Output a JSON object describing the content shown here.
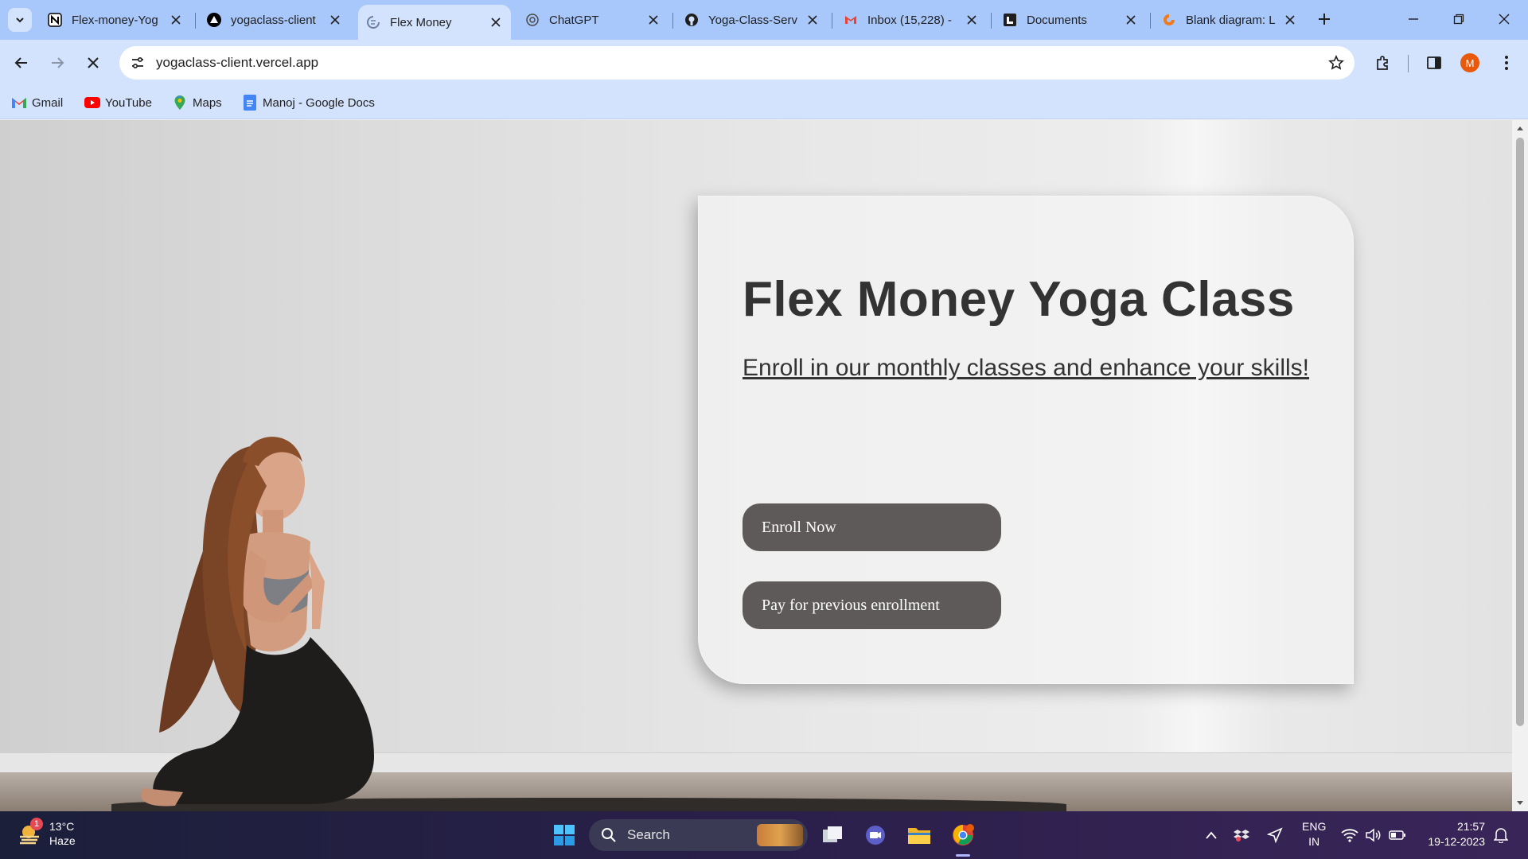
{
  "browser": {
    "tabs": [
      {
        "title": "Flex-money-Yog",
        "icon": "notion-icon",
        "active": false
      },
      {
        "title": "yogaclass-client",
        "icon": "vercel-icon",
        "active": false
      },
      {
        "title": "Flex Money",
        "icon": "loading-icon",
        "active": true
      },
      {
        "title": "ChatGPT",
        "icon": "chatgpt-icon",
        "active": false
      },
      {
        "title": "Yoga-Class-Serv",
        "icon": "github-icon",
        "active": false
      },
      {
        "title": "Inbox (15,228) -",
        "icon": "gmail-icon",
        "active": false
      },
      {
        "title": "Documents",
        "icon": "documents-icon",
        "active": false
      },
      {
        "title": "Blank diagram: L",
        "icon": "lucidchart-icon",
        "active": false
      }
    ],
    "url": "yogaclass-client.vercel.app",
    "profile_initial": "M",
    "bookmarks": [
      {
        "label": "Gmail",
        "icon": "gmail-icon"
      },
      {
        "label": "YouTube",
        "icon": "youtube-icon"
      },
      {
        "label": "Maps",
        "icon": "maps-icon"
      },
      {
        "label": "Manoj - Google Docs",
        "icon": "docs-icon"
      }
    ]
  },
  "page": {
    "title": "Flex Money Yoga Class",
    "subtitle": "Enroll in our monthly classes and enhance your skills!",
    "enroll_button": "Enroll Now",
    "pay_button": "Pay for previous enrollment"
  },
  "taskbar": {
    "weather_temp": "13°C",
    "weather_desc": "Haze",
    "weather_badge": "1",
    "search_label": "Search",
    "lang_line1": "ENG",
    "lang_line2": "IN",
    "time": "21:57",
    "date": "19-12-2023"
  },
  "colors": {
    "tab_strip": "#a8c7fa",
    "toolbar": "#d3e3fd",
    "button_bg": "#5e5a59",
    "title_text": "#333333"
  }
}
